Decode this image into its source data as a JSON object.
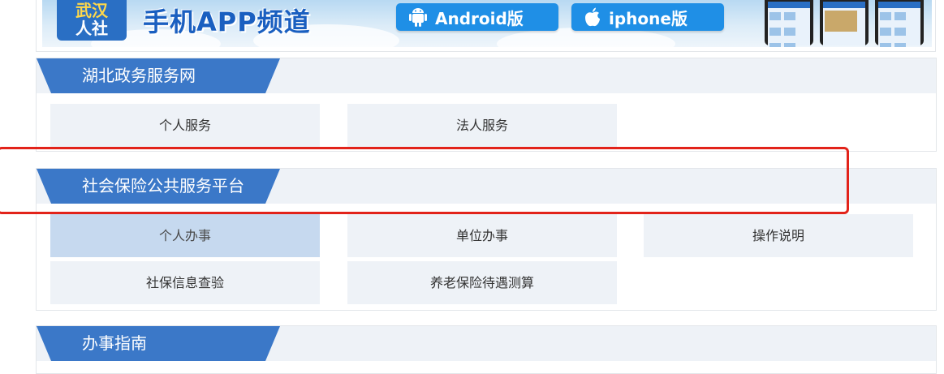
{
  "banner": {
    "logo_line1": "武汉",
    "logo_line2": "人社",
    "title": "手机APP频道",
    "android_label": "Android版",
    "iphone_label": "iphone版"
  },
  "sections": [
    {
      "title": "湖北政务服务网",
      "items": [
        "个人服务",
        "法人服务"
      ]
    },
    {
      "title": "社会保险公共服务平台",
      "items": [
        "个人办事",
        "单位办事",
        "操作说明",
        "社保信息查验",
        "养老保险待遇测算"
      ],
      "active_item": "个人办事"
    },
    {
      "title": "办事指南",
      "items": []
    }
  ],
  "colors": {
    "tab_blue": "#3b78c8",
    "item_bg": "#eef2f7",
    "item_active_bg": "#c6d9ef",
    "highlight_red": "#e2231a"
  }
}
